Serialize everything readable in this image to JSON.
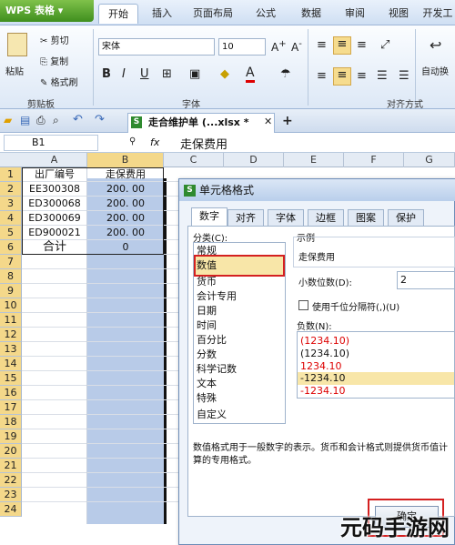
{
  "app": {
    "brand": "WPS 表格"
  },
  "menu_tabs": [
    "开始",
    "插入",
    "页面布局",
    "公式",
    "数据",
    "审阅",
    "视图",
    "开发工"
  ],
  "ribbon": {
    "clipboard": {
      "paste": "粘贴",
      "cut": "剪切",
      "copy": "复制",
      "format_painter": "格式刷",
      "group": "剪贴板"
    },
    "font": {
      "name": "宋体",
      "size": "10",
      "group": "字体",
      "bold": "B",
      "italic": "I",
      "underline": "U"
    },
    "align": {
      "group": "对齐方式",
      "wrap": "自动换"
    }
  },
  "document_tab": {
    "name": "走合维护单 (...xlsx *"
  },
  "formula_bar": {
    "cell_ref": "B1",
    "fx": "fx",
    "value": "走保费用"
  },
  "columns": [
    "A",
    "B",
    "C",
    "D",
    "E",
    "F",
    "G"
  ],
  "rows": [
    "1",
    "2",
    "3",
    "4",
    "5",
    "6",
    "7",
    "8",
    "9",
    "10",
    "11",
    "12",
    "13",
    "14",
    "15",
    "16",
    "17",
    "18",
    "19",
    "20",
    "21",
    "22",
    "23",
    "24"
  ],
  "table": {
    "headers": [
      "出厂编号",
      "走保费用"
    ],
    "data": [
      [
        "EE300308",
        "200. 00"
      ],
      [
        "ED300068",
        "200. 00"
      ],
      [
        "ED300069",
        "200. 00"
      ],
      [
        "ED900021",
        "200. 00"
      ]
    ],
    "total_label": "合计",
    "total_value": "0"
  },
  "dialog": {
    "title": "单元格格式",
    "tabs": [
      "数字",
      "对齐",
      "字体",
      "边框",
      "图案",
      "保护"
    ],
    "category_label": "分类(C):",
    "categories": [
      "常规",
      "数值",
      "货币",
      "会计专用",
      "日期",
      "时间",
      "百分比",
      "分数",
      "科学记数",
      "文本",
      "特殊",
      "自定义"
    ],
    "selected_category": "数值",
    "sample_label": "示例",
    "sample_value": "走保费用",
    "decimal_label": "小数位数(D):",
    "decimal_value": "2",
    "thousands_label": "使用千位分隔符(,)(U)",
    "negative_label": "负数(N):",
    "negatives": [
      "(1234.10)",
      "(1234.10)",
      "1234.10",
      "-1234.10",
      "-1234.10"
    ],
    "description": "数值格式用于一般数字的表示。货币和会计格式则提供货币值计算的专用格式。",
    "ok_label": "确定"
  },
  "watermark": "元码手游网",
  "colors": {
    "accent_red": "#d00000",
    "selection_blue": "#b8cbe8"
  }
}
